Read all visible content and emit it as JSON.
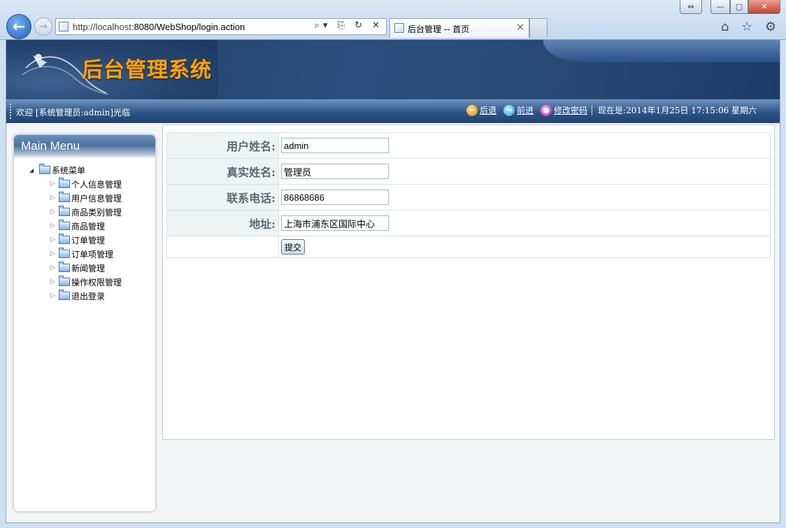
{
  "browser": {
    "url_host": "http://localhost",
    "url_rest": ":8080/WebShop/login.action",
    "tab_title": "后台管理 -- 首页",
    "tab_close": "×",
    "address_controls": "⌕▾ ⎘ ↻ ✕",
    "tools": "⌂ ☆ ⚙"
  },
  "header": {
    "system_title": "后台管理系统",
    "welcome": "欢迎 [系统管理员:admin]光临",
    "nav_back": "后退",
    "nav_forward": "前进",
    "change_password": "修改密码",
    "time": "现在是:2014年1月25日  17:15:06 星期六"
  },
  "sidebar": {
    "title": "Main Menu",
    "root": "系统菜单",
    "items": [
      {
        "label": "个人信息管理"
      },
      {
        "label": "用户信息管理"
      },
      {
        "label": "商品类别管理"
      },
      {
        "label": "商品管理"
      },
      {
        "label": "订单管理"
      },
      {
        "label": "订单项管理"
      },
      {
        "label": "新闻管理"
      },
      {
        "label": "操作权限管理"
      },
      {
        "label": "退出登录"
      }
    ]
  },
  "form": {
    "fields": [
      {
        "label": "用户姓名:",
        "value": "admin"
      },
      {
        "label": "真实姓名:",
        "value": "管理员"
      },
      {
        "label": "联系电话:",
        "value": "86868686"
      },
      {
        "label": "地址:",
        "value": "上海市浦东区国际中心"
      }
    ],
    "submit_label": "提交"
  }
}
